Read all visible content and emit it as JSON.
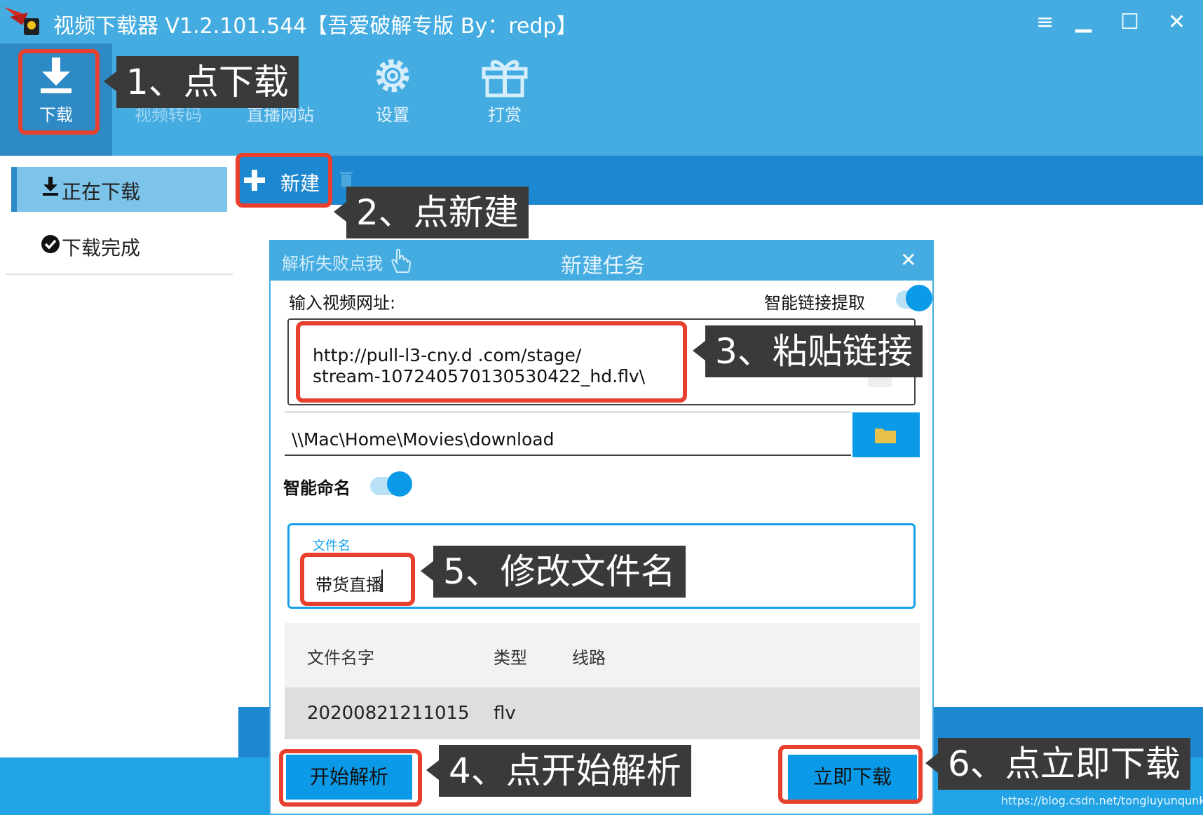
{
  "window": {
    "title": "视频下载器 V1.2.101.544【吾爱破解专版  By：redp】",
    "controls": {
      "menu": "≡",
      "minimize": "▁",
      "maximize": "☐",
      "close": "✕"
    }
  },
  "top_tabs": [
    {
      "label": "下载",
      "icon": "download-icon"
    },
    {
      "label": "视频转码",
      "icon": "convert-icon"
    },
    {
      "label": "直播网站",
      "icon": "globe-icon"
    },
    {
      "label": "设置",
      "icon": "gear-icon"
    },
    {
      "label": "打赏",
      "icon": "gift-icon"
    }
  ],
  "sidebar": {
    "items": [
      {
        "label": "正在下载",
        "icon": "download-small-icon"
      },
      {
        "label": "下载完成",
        "icon": "check-circle-icon"
      }
    ]
  },
  "toolbar": {
    "new_label": "新建"
  },
  "dialog": {
    "help_link": "解析失败点我",
    "title": "新建任务",
    "close": "✕",
    "url_label": "输入视频网址:",
    "smart_extract_label": "智能链接提取",
    "url_value_line1": "http://pull-l3-cny.d          .com/stage/",
    "url_value_line2": "stream-107240570130530422_hd.flv\\",
    "path_value": "\\\\Mac\\Home\\Movies\\download",
    "smart_name_label": "智能命名",
    "filename_float_label": "文件名",
    "filename_value": "带货直播",
    "table": {
      "headers": [
        "文件名字",
        "类型",
        "线路"
      ],
      "rows": [
        [
          "20200821211015",
          "flv",
          ""
        ]
      ]
    },
    "parse_button": "开始解析",
    "download_button": "立即下载"
  },
  "callouts": [
    "1、点下载",
    "2、点新建",
    "3、粘贴链接",
    "4、点开始解析",
    "5、修改文件名",
    "6、点立即下载"
  ],
  "watermark": "https://blog.csdn.net/tongluyunqunkong",
  "colors": {
    "titlebar": "#44ace0",
    "toolbar": "#1d87d0",
    "accent": "#0b9ae8",
    "highlight_red": "#e8402f",
    "callout_bg": "#3a3a3a"
  }
}
